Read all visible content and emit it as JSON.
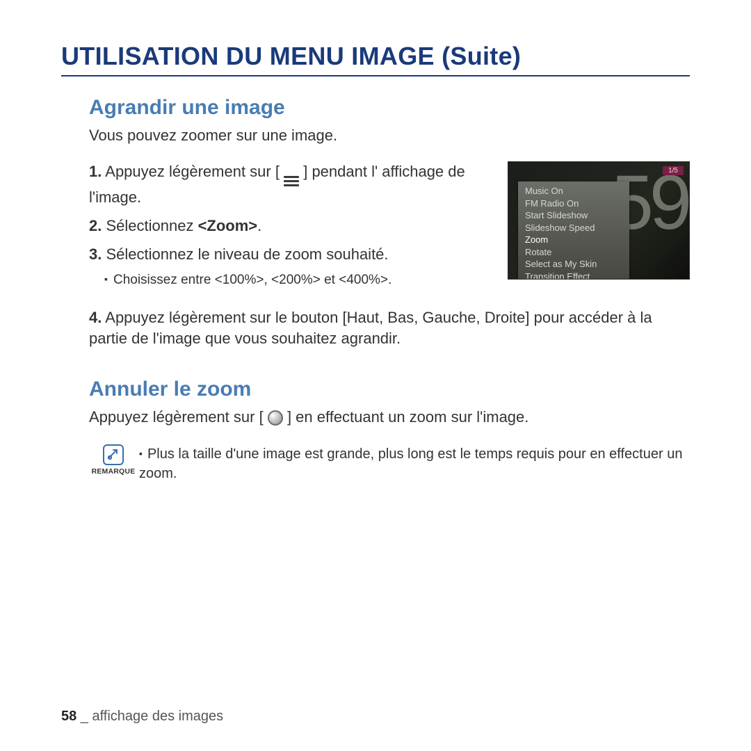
{
  "title": "UTILISATION DU MENU IMAGE (Suite)",
  "section1": {
    "heading": "Agrandir une image",
    "intro": "Vous pouvez zoomer sur une image.",
    "step1_a": "Appuyez légèrement sur [",
    "step1_b": "] pendant l' affichage de l'image.",
    "step2_a": "Sélectionnez ",
    "step2_zoom": "<Zoom>",
    "step2_b": ".",
    "step3": "Sélectionnez le niveau de zoom souhaité.",
    "bullet": "Choisissez entre <100%>, <200%> et <400%>.",
    "step4_a": "Appuyez légèrement sur le ",
    "step4_bold": "bouton [Haut, Bas, Gauche, Droite]",
    "step4_b": " pour accéder à la partie de l'image que vous souhaitez agrandir."
  },
  "device": {
    "counter": "1/5",
    "big": "59",
    "menu": [
      "Music On",
      "FM Radio On",
      "Start Slideshow",
      "Slideshow Speed",
      "Zoom",
      "Rotate",
      "Select as My Skin",
      "Transition Effect"
    ],
    "selected_index": 4
  },
  "section2": {
    "heading": "Annuler le zoom",
    "line_a": "Appuyez légèrement sur [",
    "line_b": "] en effectuant un zoom sur l'image."
  },
  "note": {
    "label": "REMARQUE",
    "text": "Plus la taille d'une image est grande, plus long est le temps requis pour en effectuer un zoom."
  },
  "footer": {
    "page": "58",
    "section": " _ affichage des images"
  }
}
